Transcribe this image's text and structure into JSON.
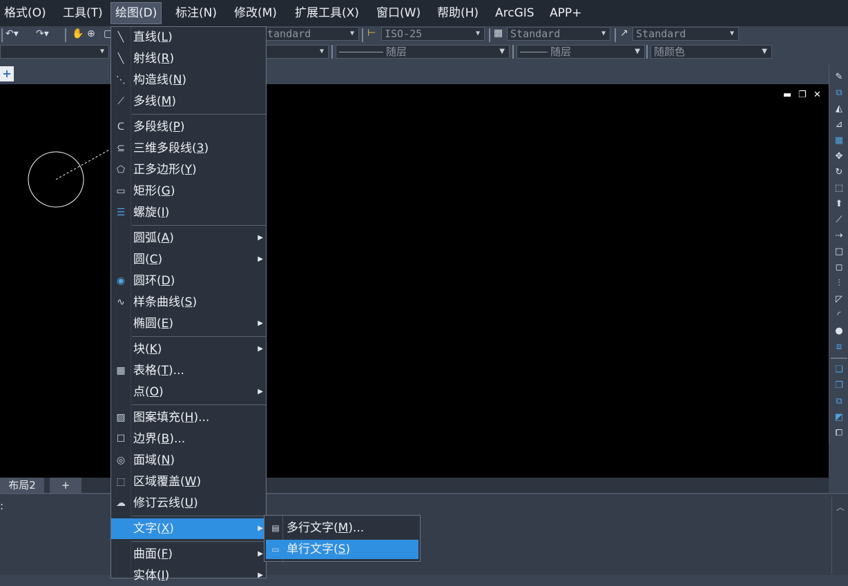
{
  "menubar": {
    "items": [
      {
        "label": "格式(O)"
      },
      {
        "label": "工具(T)"
      },
      {
        "label": "绘图(D)",
        "active": true
      },
      {
        "label": "标注(N)"
      },
      {
        "label": "修改(M)"
      },
      {
        "label": "扩展工具(X)"
      },
      {
        "label": "窗口(W)"
      },
      {
        "label": "帮助(H)"
      },
      {
        "label": "ArcGIS"
      },
      {
        "label": "APP+"
      }
    ]
  },
  "toolbar": {
    "text_style": "tandard",
    "dim_style": "ISO-25",
    "table_style": "Standard",
    "mleader_style": "Standard",
    "linetype": "随层",
    "lineweight": "随层",
    "color": "随颜色"
  },
  "layout_tabs": {
    "layout2": "布局2",
    "add": "+"
  },
  "command": {
    "prompt": ":"
  },
  "draw_menu": {
    "items": [
      {
        "label": "直线(",
        "key": "L",
        "tail": ")",
        "icon": "line-icon"
      },
      {
        "label": "射线(",
        "key": "R",
        "tail": ")",
        "icon": "ray-icon"
      },
      {
        "label": "构造线(",
        "key": "N",
        "tail": ")",
        "icon": "xline-icon"
      },
      {
        "label": "多线(",
        "key": "M",
        "tail": ")",
        "icon": "multiline-icon"
      },
      {
        "label": "多段线(",
        "key": "P",
        "tail": ")",
        "icon": "polyline-icon"
      },
      {
        "label": "三维多段线(",
        "key": "3",
        "tail": ")",
        "icon": "3d-polyline-icon"
      },
      {
        "label": "正多边形(",
        "key": "Y",
        "tail": ")",
        "icon": "polygon-icon"
      },
      {
        "label": "矩形(",
        "key": "G",
        "tail": ")",
        "icon": "rectangle-icon"
      },
      {
        "label": "螺旋(",
        "key": "I",
        "tail": ")",
        "icon": "helix-icon"
      },
      {
        "label": "圆弧(",
        "key": "A",
        "tail": ")",
        "submenu": true
      },
      {
        "label": "圆(",
        "key": "C",
        "tail": ")",
        "submenu": true
      },
      {
        "label": "圆环(",
        "key": "D",
        "tail": ")",
        "icon": "donut-icon"
      },
      {
        "label": "样条曲线(",
        "key": "S",
        "tail": ")",
        "icon": "spline-icon"
      },
      {
        "label": "椭圆(",
        "key": "E",
        "tail": ")",
        "submenu": true
      },
      {
        "label": "块(",
        "key": "K",
        "tail": ")",
        "submenu": true
      },
      {
        "label": "表格(",
        "key": "T",
        "tail": ")...",
        "icon": "table-icon"
      },
      {
        "label": "点(",
        "key": "O",
        "tail": ")",
        "submenu": true
      },
      {
        "label": "图案填充(",
        "key": "H",
        "tail": ")...",
        "icon": "hatch-icon"
      },
      {
        "label": "边界(",
        "key": "B",
        "tail": ")...",
        "icon": "boundary-icon"
      },
      {
        "label": "面域(",
        "key": "N",
        "tail": ")",
        "icon": "region-icon"
      },
      {
        "label": "区域覆盖(",
        "key": "W",
        "tail": ")",
        "icon": "wipeout-icon"
      },
      {
        "label": "修订云线(",
        "key": "U",
        "tail": ")",
        "icon": "revcloud-icon"
      },
      {
        "label": "文字(",
        "key": "X",
        "tail": ")",
        "submenu": true,
        "highlighted": true
      },
      {
        "label": "曲面(",
        "key": "F",
        "tail": ")",
        "submenu": true
      },
      {
        "label": "实体(",
        "key": "I",
        "tail": ")",
        "submenu": true
      }
    ]
  },
  "text_submenu": {
    "items": [
      {
        "label": "多行文字(",
        "key": "M",
        "tail": ")...",
        "icon": "mtext-icon"
      },
      {
        "label": "单行文字(",
        "key": "S",
        "tail": ")",
        "icon": "dtext-icon",
        "highlighted": true
      }
    ]
  }
}
